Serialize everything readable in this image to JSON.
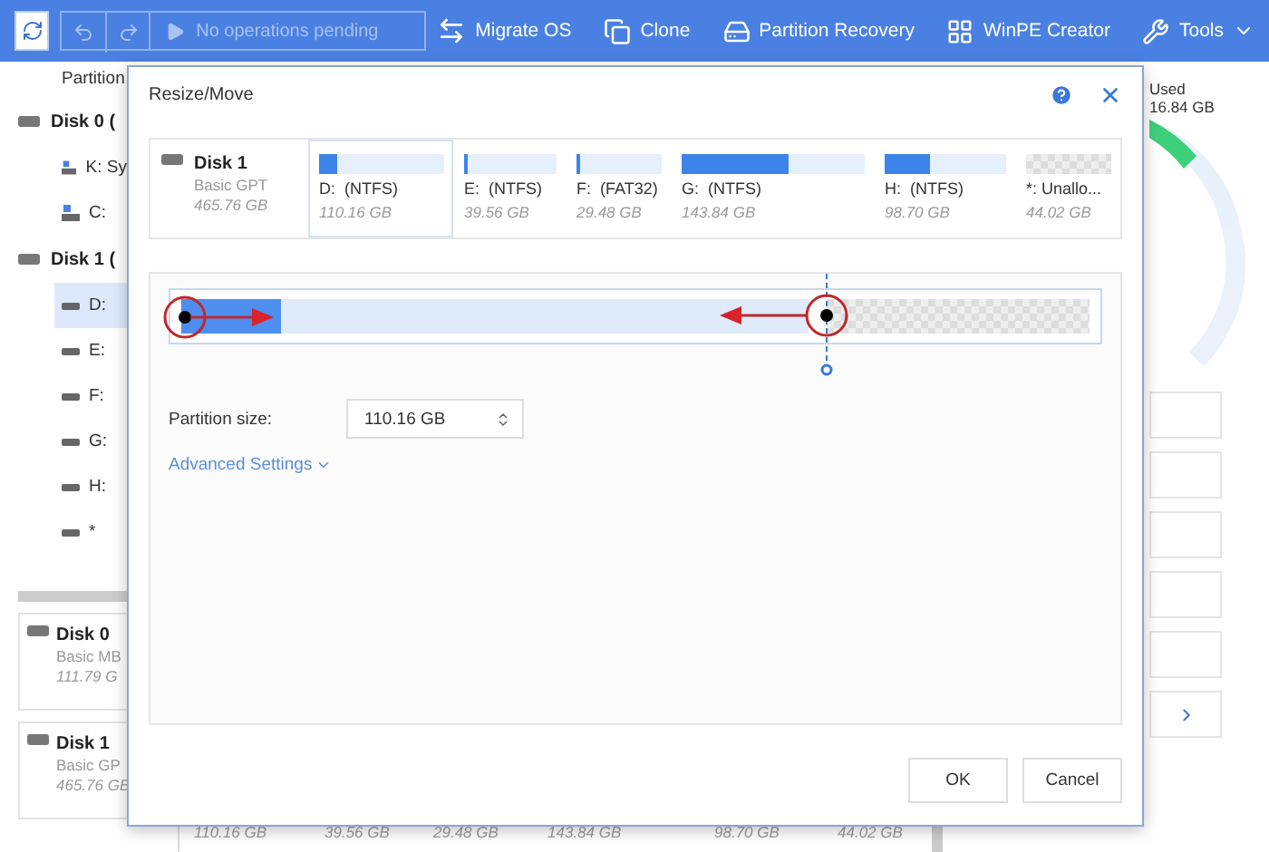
{
  "toolbar": {
    "pending": {
      "label": "No operations pending",
      "disabled": true
    },
    "tools": [
      {
        "label": "Migrate OS",
        "kind": "migrate"
      },
      {
        "label": "Clone",
        "kind": "clone"
      },
      {
        "label": "Partition Recovery",
        "kind": "recovery"
      },
      {
        "label": "WinPE Creator",
        "kind": "winpe"
      },
      {
        "label": "Tools",
        "kind": "menu"
      }
    ]
  },
  "sidebar": {
    "header": "Partition",
    "disks": [
      {
        "label": "Disk 0 (",
        "children": [
          {
            "label": "K: Sy",
            "kind": "system",
            "selected": false
          },
          {
            "label": "C:",
            "kind": "system",
            "selected": false
          }
        ]
      },
      {
        "label": "Disk 1 (",
        "children": [
          {
            "label": "D:",
            "kind": "drive",
            "selected": true
          },
          {
            "label": "E:",
            "kind": "drive",
            "selected": false
          },
          {
            "label": "F:",
            "kind": "drive",
            "selected": false
          },
          {
            "label": "G:",
            "kind": "drive",
            "selected": false
          },
          {
            "label": "H:",
            "kind": "drive",
            "selected": false
          },
          {
            "label": "*",
            "kind": "drive",
            "selected": false
          }
        ]
      }
    ]
  },
  "disk_cards": [
    {
      "name": "Disk 0",
      "type": "Basic MB",
      "size": "111.79 G"
    },
    {
      "name": "Disk 1",
      "type": "Basic GP",
      "size": "465.76 GB"
    }
  ],
  "size_strip": [
    "110.16 GB",
    "39.56 GB",
    "29.48 GB",
    "143.84 GB",
    "98.70 GB",
    "44.02 GB"
  ],
  "summary": {
    "label": "Used",
    "value": "16.84 GB"
  },
  "dialog": {
    "title": "Resize/Move",
    "disk": {
      "name": "Disk 1",
      "type": "Basic GPT",
      "size": "465.76 GB"
    },
    "partitions": [
      {
        "label": "D:  (NTFS)",
        "size": "110.16 GB",
        "level": 0.15,
        "selected": true,
        "kind": "partition"
      },
      {
        "label": "E:  (NTFS)",
        "size": "39.56 GB",
        "level": 0.03,
        "selected": false,
        "kind": "partition"
      },
      {
        "label": "F:  (FAT32)",
        "size": "29.48 GB",
        "level": 0.03,
        "selected": false,
        "kind": "partition"
      },
      {
        "label": "G:  (NTFS)",
        "size": "143.84 GB",
        "level": 0.58,
        "selected": false,
        "kind": "partition"
      },
      {
        "label": "H:  (NTFS)",
        "size": "98.70 GB",
        "level": 0.37,
        "selected": false,
        "kind": "partition"
      },
      {
        "label": "*: Unallo...",
        "size": "44.02 GB",
        "selected": false,
        "kind": "unallocated"
      }
    ],
    "resize_bar": {
      "level": 0.71
    },
    "size_field": {
      "label": "Partition size:",
      "value": "110.16 GB"
    },
    "advanced": "Advanced Settings",
    "buttons": [
      "OK",
      "Cancel"
    ]
  }
}
